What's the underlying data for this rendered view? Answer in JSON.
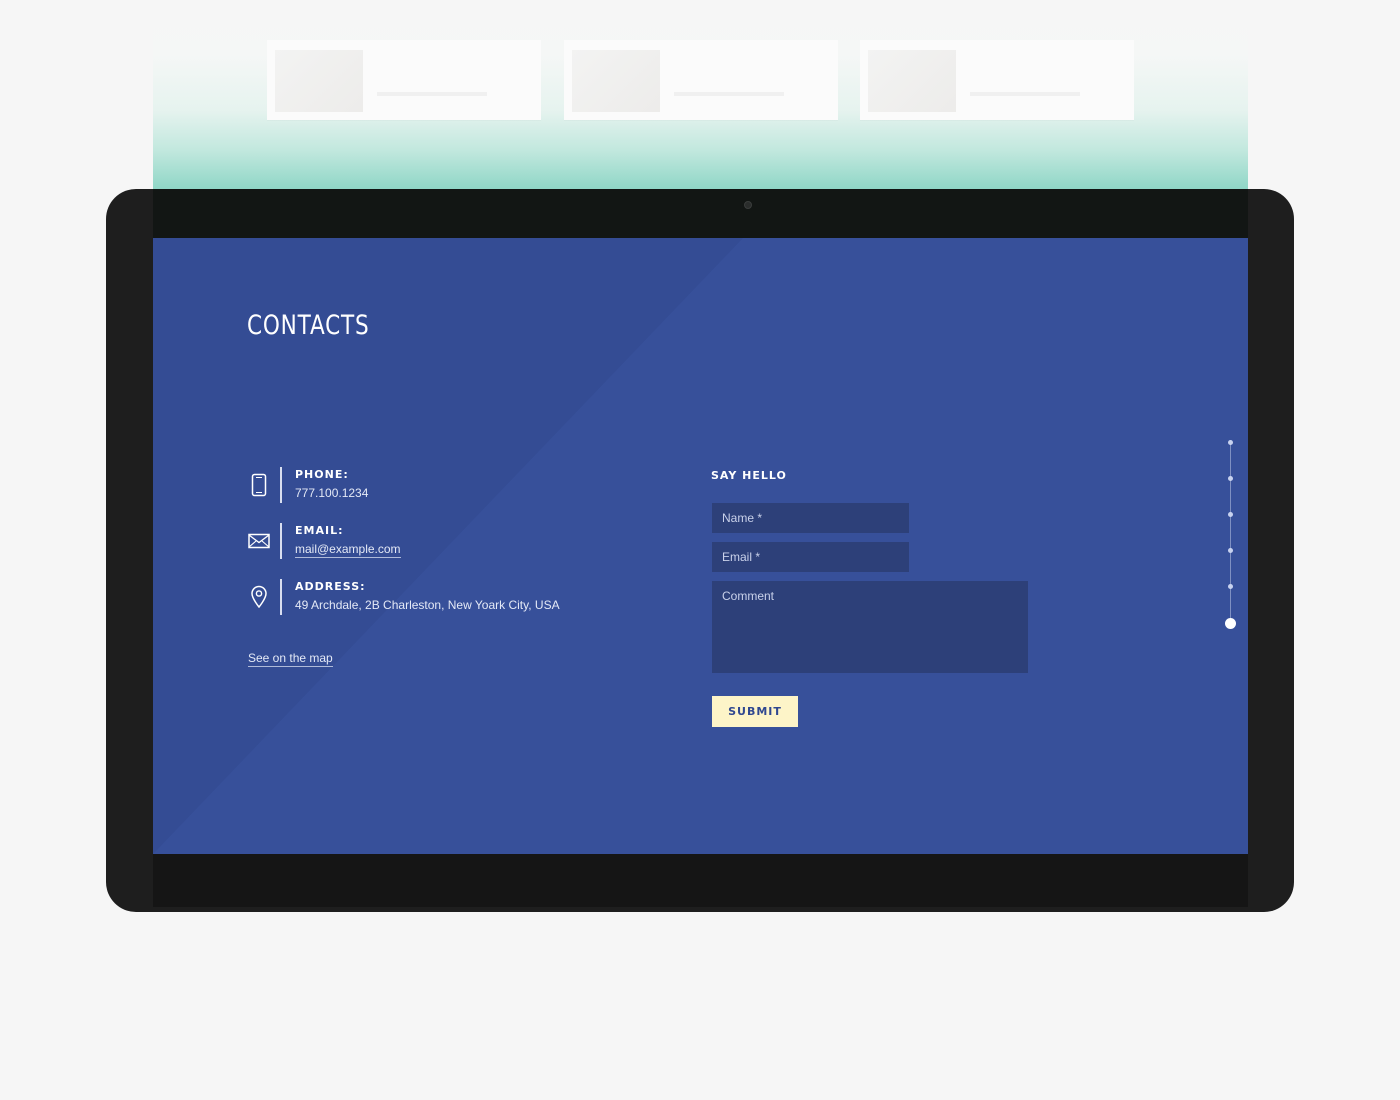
{
  "contacts": {
    "title": "CONTACTS",
    "items": [
      {
        "label": "PHONE:",
        "value": "777.100.1234",
        "icon": "phone-icon"
      },
      {
        "label": "EMAIL:",
        "value": "mail@example.com",
        "icon": "envelope-icon"
      },
      {
        "label": "ADDRESS:",
        "value": "49 Archdale, 2B Charleston, New Yoark City, USA",
        "icon": "map-pin-icon"
      }
    ],
    "map_link": "See on the map"
  },
  "form": {
    "heading": "SAY HELLO",
    "name_placeholder": "Name *",
    "email_placeholder": "Email *",
    "comment_placeholder": "Comment",
    "submit_label": "SUBMIT"
  },
  "section_nav": {
    "count": 6,
    "active_index": 5
  },
  "colors": {
    "screen_background": "#37509a",
    "field_background": "#2d4079",
    "submit_background": "#fdf4c8",
    "submit_text": "#2f4790",
    "device_frame": "#1e1e1e",
    "page_background": "#f6f6f6",
    "mint_accent": "#7fd1bf"
  }
}
